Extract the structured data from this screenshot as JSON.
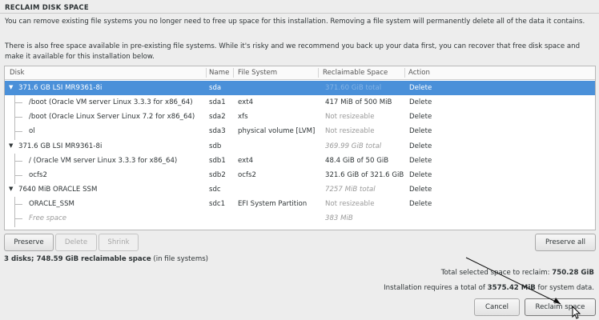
{
  "title": "RECLAIM DISK SPACE",
  "intro_line1": "You can remove existing file systems you no longer need to free up space for this installation.  Removing a file system will permanently delete all of the data it contains.",
  "intro_line2": "There is also free space available in pre-existing file systems.  While it's risky and we recommend you back up your data first, you can recover that free disk space and make it available for this installation below.",
  "columns": {
    "disk": "Disk",
    "name": "Name",
    "fs": "File System",
    "reclaimable": "Reclaimable Space",
    "action": "Action"
  },
  "rows": [
    {
      "disk": "371.6 GB LSI MR9361-8i",
      "name": "sda",
      "fs": "",
      "space": "371.60 GiB total",
      "action": "Delete"
    },
    {
      "disk": "/boot (Oracle VM server Linux 3.3.3 for x86_64)",
      "name": "sda1",
      "fs": "ext4",
      "space": "417 MiB of 500 MiB",
      "action": "Delete"
    },
    {
      "disk": "/boot (Oracle Linux Server Linux 7.2 for x86_64)",
      "name": "sda2",
      "fs": "xfs",
      "space": "Not resizeable",
      "action": "Delete"
    },
    {
      "disk": "ol",
      "name": "sda3",
      "fs": "physical volume [LVM]",
      "space": "Not resizeable",
      "action": "Delete"
    },
    {
      "disk": "371.6 GB LSI MR9361-8i",
      "name": "sdb",
      "fs": "",
      "space": "369.99 GiB total",
      "action": "Delete"
    },
    {
      "disk": "/ (Oracle VM server Linux 3.3.3 for x86_64)",
      "name": "sdb1",
      "fs": "ext4",
      "space": "48.4 GiB of 50 GiB",
      "action": "Delete"
    },
    {
      "disk": "ocfs2",
      "name": "sdb2",
      "fs": "ocfs2",
      "space": "321.6 GiB of 321.6 GiB",
      "action": "Delete"
    },
    {
      "disk": "7640 MiB ORACLE SSM",
      "name": "sdc",
      "fs": "",
      "space": "7257 MiB total",
      "action": "Delete"
    },
    {
      "disk": "ORACLE_SSM",
      "name": "sdc1",
      "fs": "EFI System Partition",
      "space": "Not resizeable",
      "action": "Delete"
    },
    {
      "disk": "Free space",
      "name": "",
      "fs": "",
      "space": "383 MiB",
      "action": ""
    }
  ],
  "buttons": {
    "preserve": "Preserve",
    "delete": "Delete",
    "shrink": "Shrink",
    "preserve_all": "Preserve all",
    "cancel": "Cancel",
    "reclaim": "Reclaim space"
  },
  "summary": {
    "bold": "3 disks; 748.59 GiB reclaimable space",
    "rest": " (in file systems)"
  },
  "totals": {
    "selected_label": "Total selected space to reclaim: ",
    "selected_value": "750.28 GiB",
    "requires_prefix": "Installation requires a total of ",
    "requires_value": "3575.42 MiB",
    "requires_suffix": " for system data."
  }
}
